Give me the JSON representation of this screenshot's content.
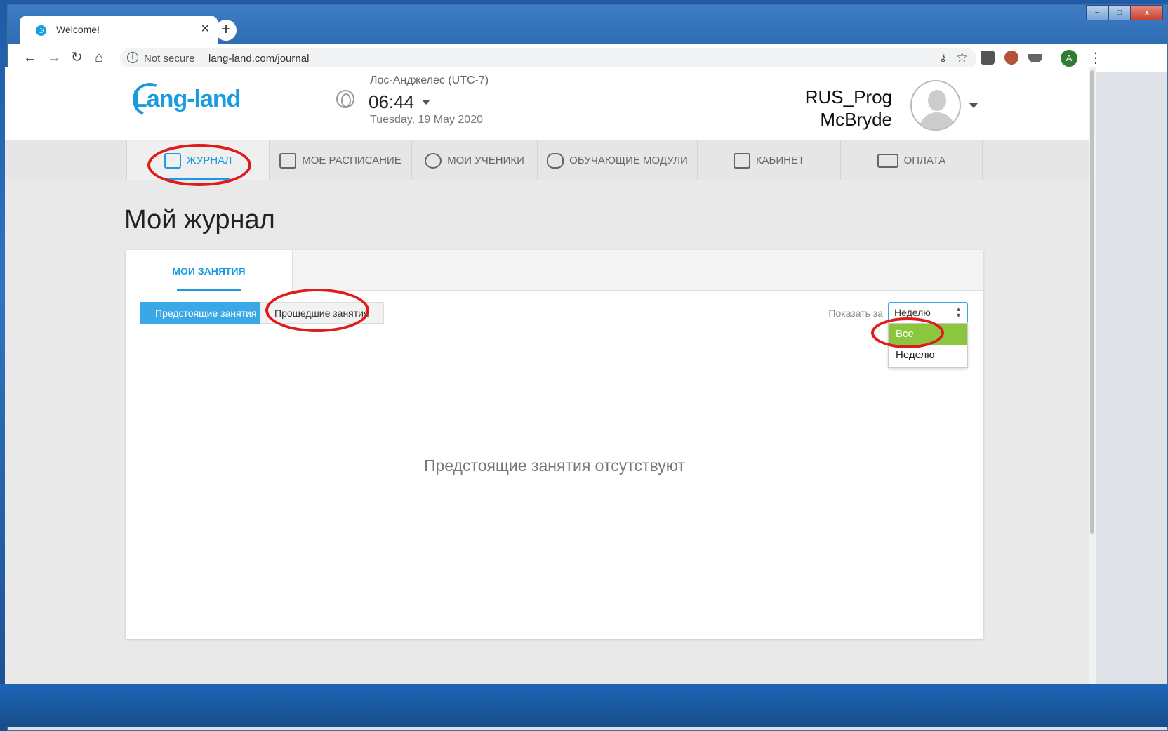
{
  "browser": {
    "tab_title": "Welcome!",
    "tab_close": "×",
    "new_tab": "+",
    "security": "Not secure",
    "url": "lang-land.com/journal",
    "profile_initial": "A",
    "window_controls": [
      "–",
      "□",
      "x"
    ]
  },
  "header": {
    "logo": "Lang-land",
    "timezone": "Лос-Анджелес (UTC-7)",
    "time": "06:44",
    "date": "Tuesday, 19 May 2020",
    "user_line1": "RUS_Prog",
    "user_line2": "McBryde"
  },
  "nav": {
    "items": [
      {
        "label": "ЖУРНАЛ",
        "icon": "journal-icon",
        "active": true
      },
      {
        "label": "МОЕ РАСПИСАНИЕ",
        "icon": "calendar-icon",
        "active": false
      },
      {
        "label": "МОИ УЧЕНИКИ",
        "icon": "students-icon",
        "active": false
      },
      {
        "label": "ОБУЧАЮЩИЕ МОДУЛИ",
        "icon": "puzzle-icon",
        "active": false
      },
      {
        "label": "КАБИНЕТ",
        "icon": "cabinet-icon",
        "active": false
      },
      {
        "label": "ОПЛАТА",
        "icon": "card-icon",
        "active": false
      }
    ]
  },
  "main": {
    "title": "Мой журнал",
    "tab": "МОИ ЗАНЯТИЯ",
    "upcoming_button": "Предстоящие занятия",
    "past_button": "Прошедшие занятия",
    "show_for_label": "Показать за",
    "period_selected": "Неделю",
    "period_options": [
      "Все",
      "Неделю"
    ],
    "highlighted_option": "Все",
    "empty_message": "Предстоящие занятия отсутствуют"
  },
  "colors": {
    "accent": "#1a9be0",
    "upcoming_bg": "#3aa8e6",
    "option_highlight": "#8cc63f",
    "annotation": "#e01b1b"
  }
}
